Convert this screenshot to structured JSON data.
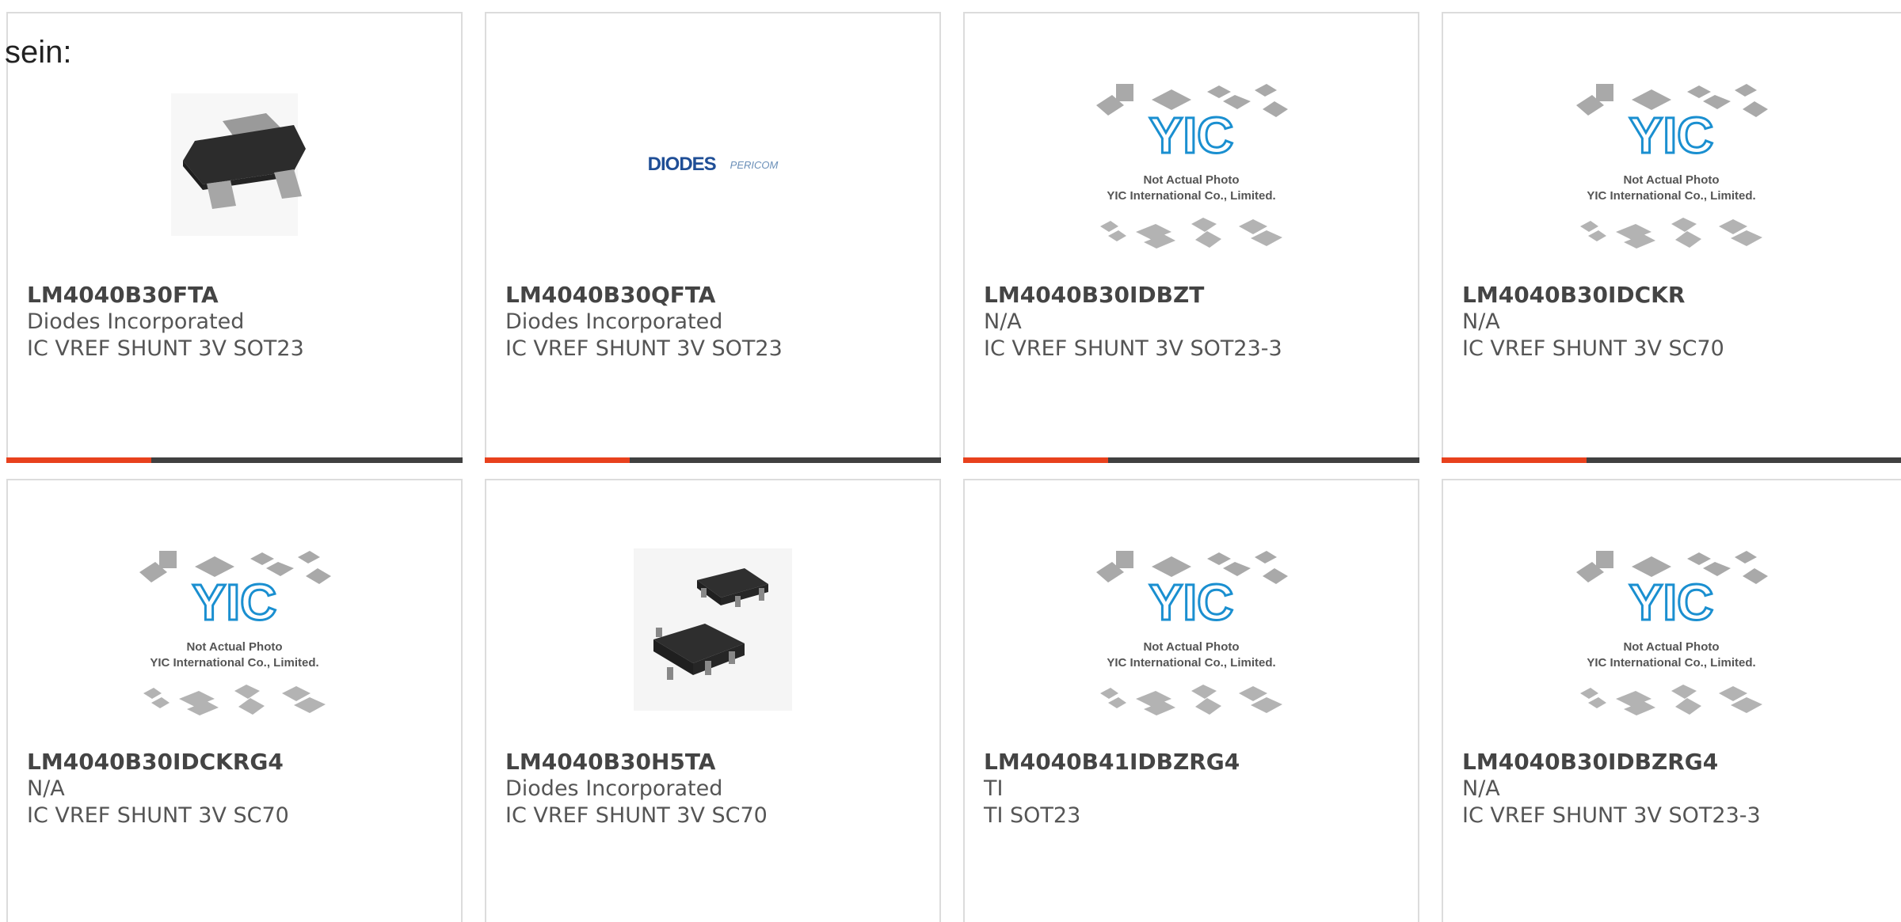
{
  "intro_text": "sein:",
  "colors": {
    "accent": "#e8411d",
    "bar": "#404040",
    "yic_blue": "#1a8fd0"
  },
  "placeholder_caption": {
    "line1": "Not Actual Photo",
    "line2": "YIC International Co., Limited."
  },
  "products": [
    {
      "pn": "LM4040B30FTA",
      "manufacturer": "Diodes Incorporated",
      "description": "IC VREF SHUNT 3V SOT23",
      "image": "sot23-chip-icon"
    },
    {
      "pn": "LM4040B30QFTA",
      "manufacturer": "Diodes Incorporated",
      "description": "IC VREF SHUNT 3V SOT23",
      "image": "diodes-logo",
      "logo_text": "DIODES",
      "logo_text2": "PERICOM"
    },
    {
      "pn": "LM4040B30IDBZT",
      "manufacturer": "N/A",
      "description": "IC VREF SHUNT 3V SOT23-3",
      "image": "yic-placeholder"
    },
    {
      "pn": "LM4040B30IDCKR",
      "manufacturer": "N/A",
      "description": "IC VREF SHUNT 3V SC70",
      "image": "yic-placeholder"
    },
    {
      "pn": "LM4040B30IDCKRG4",
      "manufacturer": "N/A",
      "description": "IC VREF SHUNT 3V SC70",
      "image": "yic-placeholder"
    },
    {
      "pn": "LM4040B30H5TA",
      "manufacturer": "Diodes Incorporated",
      "description": "IC VREF SHUNT 3V SC70",
      "image": "sc70-chip-icon"
    },
    {
      "pn": "LM4040B41IDBZRG4",
      "manufacturer": "TI",
      "description": "TI SOT23",
      "image": "yic-placeholder"
    },
    {
      "pn": "LM4040B30IDBZRG4",
      "manufacturer": "N/A",
      "description": "IC VREF SHUNT 3V SOT23-3",
      "image": "yic-placeholder"
    }
  ]
}
